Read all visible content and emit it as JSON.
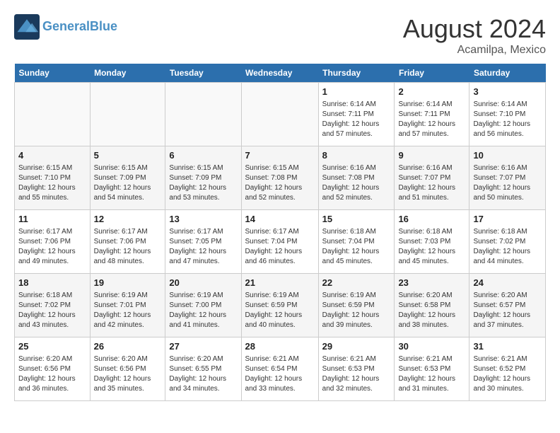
{
  "header": {
    "logo_line1": "General",
    "logo_line2": "Blue",
    "month": "August 2024",
    "location": "Acamilpa, Mexico"
  },
  "days_of_week": [
    "Sunday",
    "Monday",
    "Tuesday",
    "Wednesday",
    "Thursday",
    "Friday",
    "Saturday"
  ],
  "weeks": [
    [
      {
        "day": "",
        "info": ""
      },
      {
        "day": "",
        "info": ""
      },
      {
        "day": "",
        "info": ""
      },
      {
        "day": "",
        "info": ""
      },
      {
        "day": "1",
        "info": "Sunrise: 6:14 AM\nSunset: 7:11 PM\nDaylight: 12 hours\nand 57 minutes."
      },
      {
        "day": "2",
        "info": "Sunrise: 6:14 AM\nSunset: 7:11 PM\nDaylight: 12 hours\nand 57 minutes."
      },
      {
        "day": "3",
        "info": "Sunrise: 6:14 AM\nSunset: 7:10 PM\nDaylight: 12 hours\nand 56 minutes."
      }
    ],
    [
      {
        "day": "4",
        "info": "Sunrise: 6:15 AM\nSunset: 7:10 PM\nDaylight: 12 hours\nand 55 minutes."
      },
      {
        "day": "5",
        "info": "Sunrise: 6:15 AM\nSunset: 7:09 PM\nDaylight: 12 hours\nand 54 minutes."
      },
      {
        "day": "6",
        "info": "Sunrise: 6:15 AM\nSunset: 7:09 PM\nDaylight: 12 hours\nand 53 minutes."
      },
      {
        "day": "7",
        "info": "Sunrise: 6:15 AM\nSunset: 7:08 PM\nDaylight: 12 hours\nand 52 minutes."
      },
      {
        "day": "8",
        "info": "Sunrise: 6:16 AM\nSunset: 7:08 PM\nDaylight: 12 hours\nand 52 minutes."
      },
      {
        "day": "9",
        "info": "Sunrise: 6:16 AM\nSunset: 7:07 PM\nDaylight: 12 hours\nand 51 minutes."
      },
      {
        "day": "10",
        "info": "Sunrise: 6:16 AM\nSunset: 7:07 PM\nDaylight: 12 hours\nand 50 minutes."
      }
    ],
    [
      {
        "day": "11",
        "info": "Sunrise: 6:17 AM\nSunset: 7:06 PM\nDaylight: 12 hours\nand 49 minutes."
      },
      {
        "day": "12",
        "info": "Sunrise: 6:17 AM\nSunset: 7:06 PM\nDaylight: 12 hours\nand 48 minutes."
      },
      {
        "day": "13",
        "info": "Sunrise: 6:17 AM\nSunset: 7:05 PM\nDaylight: 12 hours\nand 47 minutes."
      },
      {
        "day": "14",
        "info": "Sunrise: 6:17 AM\nSunset: 7:04 PM\nDaylight: 12 hours\nand 46 minutes."
      },
      {
        "day": "15",
        "info": "Sunrise: 6:18 AM\nSunset: 7:04 PM\nDaylight: 12 hours\nand 45 minutes."
      },
      {
        "day": "16",
        "info": "Sunrise: 6:18 AM\nSunset: 7:03 PM\nDaylight: 12 hours\nand 45 minutes."
      },
      {
        "day": "17",
        "info": "Sunrise: 6:18 AM\nSunset: 7:02 PM\nDaylight: 12 hours\nand 44 minutes."
      }
    ],
    [
      {
        "day": "18",
        "info": "Sunrise: 6:18 AM\nSunset: 7:02 PM\nDaylight: 12 hours\nand 43 minutes."
      },
      {
        "day": "19",
        "info": "Sunrise: 6:19 AM\nSunset: 7:01 PM\nDaylight: 12 hours\nand 42 minutes."
      },
      {
        "day": "20",
        "info": "Sunrise: 6:19 AM\nSunset: 7:00 PM\nDaylight: 12 hours\nand 41 minutes."
      },
      {
        "day": "21",
        "info": "Sunrise: 6:19 AM\nSunset: 6:59 PM\nDaylight: 12 hours\nand 40 minutes."
      },
      {
        "day": "22",
        "info": "Sunrise: 6:19 AM\nSunset: 6:59 PM\nDaylight: 12 hours\nand 39 minutes."
      },
      {
        "day": "23",
        "info": "Sunrise: 6:20 AM\nSunset: 6:58 PM\nDaylight: 12 hours\nand 38 minutes."
      },
      {
        "day": "24",
        "info": "Sunrise: 6:20 AM\nSunset: 6:57 PM\nDaylight: 12 hours\nand 37 minutes."
      }
    ],
    [
      {
        "day": "25",
        "info": "Sunrise: 6:20 AM\nSunset: 6:56 PM\nDaylight: 12 hours\nand 36 minutes."
      },
      {
        "day": "26",
        "info": "Sunrise: 6:20 AM\nSunset: 6:56 PM\nDaylight: 12 hours\nand 35 minutes."
      },
      {
        "day": "27",
        "info": "Sunrise: 6:20 AM\nSunset: 6:55 PM\nDaylight: 12 hours\nand 34 minutes."
      },
      {
        "day": "28",
        "info": "Sunrise: 6:21 AM\nSunset: 6:54 PM\nDaylight: 12 hours\nand 33 minutes."
      },
      {
        "day": "29",
        "info": "Sunrise: 6:21 AM\nSunset: 6:53 PM\nDaylight: 12 hours\nand 32 minutes."
      },
      {
        "day": "30",
        "info": "Sunrise: 6:21 AM\nSunset: 6:53 PM\nDaylight: 12 hours\nand 31 minutes."
      },
      {
        "day": "31",
        "info": "Sunrise: 6:21 AM\nSunset: 6:52 PM\nDaylight: 12 hours\nand 30 minutes."
      }
    ]
  ]
}
